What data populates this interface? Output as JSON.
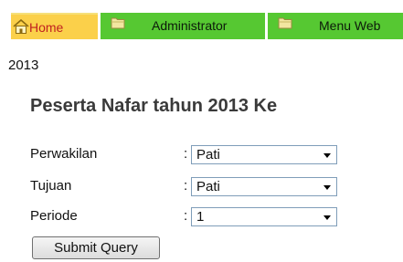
{
  "nav": {
    "tabs": [
      {
        "label": "Home",
        "icon": "home-icon"
      },
      {
        "label": "Administrator",
        "icon": "folder-icon"
      },
      {
        "label": "Menu Web",
        "icon": "folder-icon"
      }
    ]
  },
  "year_text": "2013",
  "page_title": "Peserta Nafar tahun 2013 Ke",
  "form": {
    "fields": [
      {
        "label": "Perwakilan",
        "colon": ":",
        "value": "Pati"
      },
      {
        "label": "Tujuan",
        "colon": ":",
        "value": "Pati"
      },
      {
        "label": "Periode",
        "colon": ":",
        "value": "1"
      }
    ],
    "submit_label": "Submit Query"
  },
  "colors": {
    "home_tab": "#fbd04a",
    "tab_green": "#56c832",
    "home_label": "#c02020",
    "title": "#3a3a3a"
  }
}
